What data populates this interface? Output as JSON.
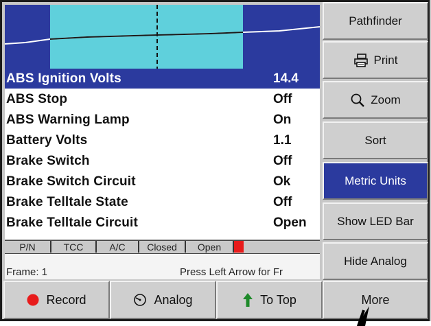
{
  "list": {
    "rows": [
      {
        "name": "ABS Ignition Volts",
        "value": "14.4",
        "selected": true
      },
      {
        "name": "ABS Stop",
        "value": "Off"
      },
      {
        "name": "ABS Warning Lamp",
        "value": "On"
      },
      {
        "name": "Battery Volts",
        "value": "1.1"
      },
      {
        "name": "Brake Switch",
        "value": "Off"
      },
      {
        "name": "Brake Switch Circuit",
        "value": "Ok"
      },
      {
        "name": "Brake Telltale State",
        "value": "Off"
      },
      {
        "name": "Brake Telltale Circuit",
        "value": "Open"
      }
    ]
  },
  "status": {
    "cells": [
      "P/N",
      "TCC",
      "A/C",
      "Closed",
      "Open"
    ],
    "frame_label": "Frame: 1",
    "hint": "Press Left Arrow for Fr"
  },
  "side_buttons": {
    "pathfinder": "Pathfinder",
    "print": "Print",
    "zoom": "Zoom",
    "sort": "Sort",
    "metric_units": "Metric Units",
    "show_led_bar": "Show LED Bar",
    "hide_analog": "Hide Analog"
  },
  "bottom_buttons": {
    "record": "Record",
    "analog": "Analog",
    "to_top": "To Top",
    "more": "More"
  },
  "icons": {
    "print": "printer-icon",
    "zoom": "magnifier-icon",
    "record": "red-dot-icon",
    "analog": "gauge-icon",
    "to_top": "green-up-arrow-icon"
  },
  "colors": {
    "selection": "#2b3a9e",
    "graph_band": "#5fd0dc",
    "led_red": "#e81b1b",
    "record_red": "#e81b1b",
    "arrow_green": "#1e8a2a"
  }
}
